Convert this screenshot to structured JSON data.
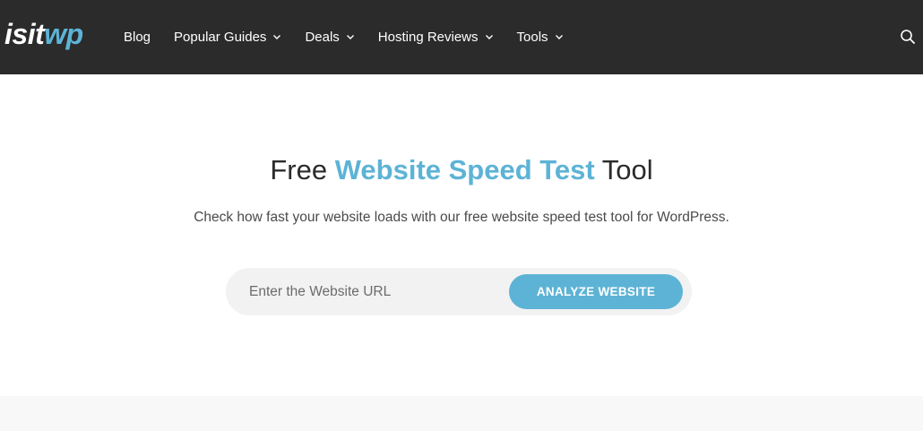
{
  "header": {
    "logo": {
      "part1": "isit",
      "part2": "wp"
    },
    "nav": [
      {
        "label": "Blog",
        "has_dropdown": false
      },
      {
        "label": "Popular Guides",
        "has_dropdown": true
      },
      {
        "label": "Deals",
        "has_dropdown": true
      },
      {
        "label": "Hosting Reviews",
        "has_dropdown": true
      },
      {
        "label": "Tools",
        "has_dropdown": true
      }
    ],
    "search_icon": "search-icon"
  },
  "hero": {
    "title_prefix": "Free ",
    "title_accent": "Website Speed Test",
    "title_suffix": " Tool",
    "subtitle": "Check how fast your website loads with our free website speed test tool for WordPress."
  },
  "form": {
    "url_placeholder": "Enter the Website URL",
    "url_value": "",
    "submit_label": "ANALYZE WEBSITE"
  },
  "colors": {
    "nav_bg": "#2b2b2b",
    "accent": "#5db3d6",
    "input_bg": "#f2f2f2"
  }
}
